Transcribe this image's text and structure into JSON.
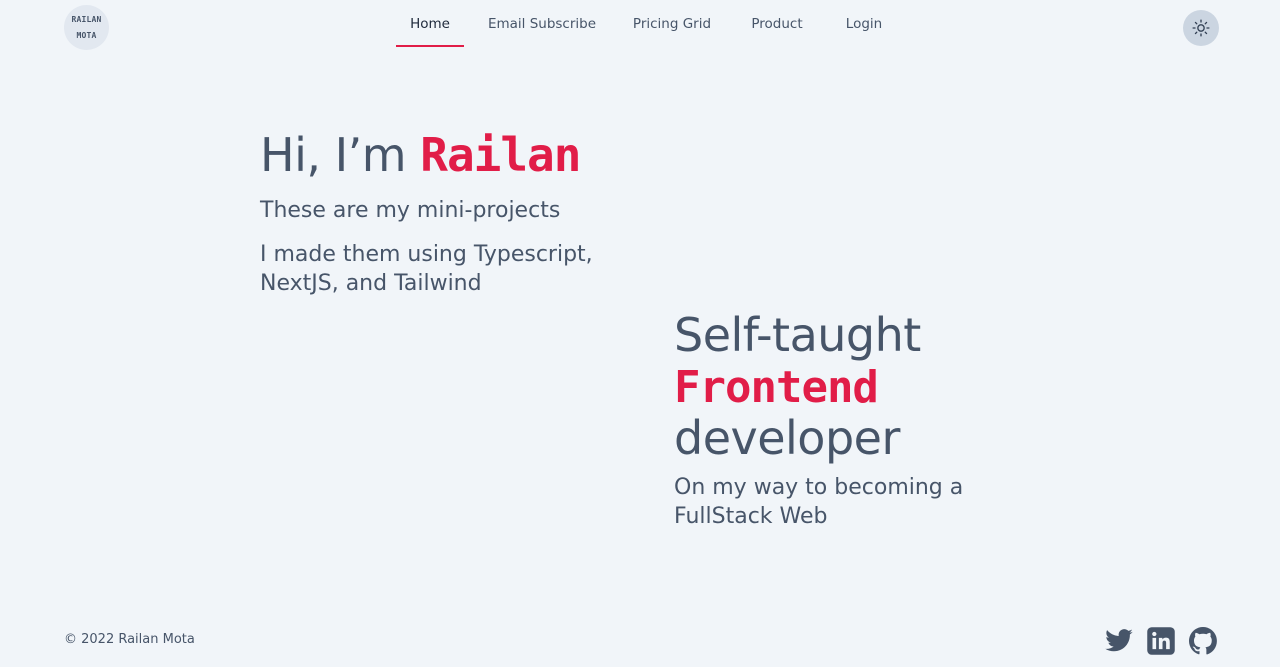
{
  "logo": {
    "line1": "RAILAN",
    "line2": "MOTA"
  },
  "nav": {
    "items": [
      {
        "label": "Home",
        "active": true
      },
      {
        "label": "Email Subscribe",
        "active": false
      },
      {
        "label": "Pricing Grid",
        "active": false
      },
      {
        "label": "Product",
        "active": false
      },
      {
        "label": "Login",
        "active": false
      }
    ],
    "theme_toggle_icon": "sun-icon"
  },
  "hero": {
    "greeting": "Hi, I’m",
    "name": "Railan",
    "subtitle": "These are my mini-projects",
    "description": "I made them using Typescript, NextJS, and Tailwind"
  },
  "developer": {
    "line1": "Self-taught",
    "accent": "Frontend",
    "line3": "developer",
    "subtitle": "On my way to becoming a FullStack Web"
  },
  "footer": {
    "copyright": "© 2022 Railan Mota",
    "social": [
      "twitter-icon",
      "linkedin-icon",
      "github-icon"
    ]
  },
  "colors": {
    "background": "#f1f5f9",
    "text": "#475569",
    "accent": "#e11d48"
  }
}
